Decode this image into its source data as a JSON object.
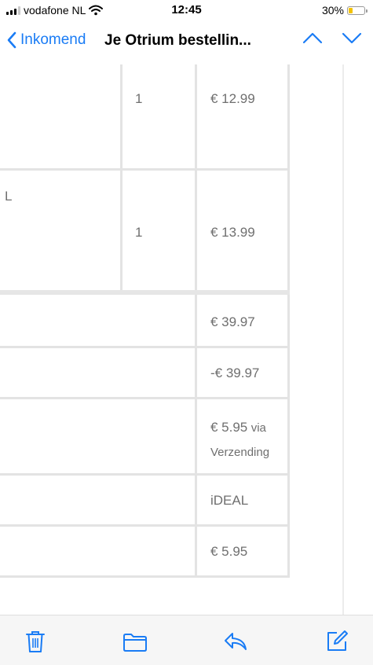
{
  "status_bar": {
    "carrier": "vodafone NL",
    "time": "12:45",
    "battery": "30%",
    "battery_level": 0.3
  },
  "nav": {
    "back_label": "Inkomend",
    "title": "Je Otrium bestellin...",
    "icons": {
      "back": "chevron-left-icon",
      "prev": "chevron-up-icon",
      "next": "chevron-down-icon"
    }
  },
  "items": [
    {
      "name": "",
      "qty": "1",
      "price": "€ 12.99"
    },
    {
      "name": "L",
      "qty": "1",
      "price": "€ 13.99"
    }
  ],
  "summary": {
    "subtotal": "€ 39.97",
    "discount": "-€ 39.97",
    "shipping_price": "€ 5.95",
    "shipping_via": "via",
    "shipping_method": "Verzending",
    "payment": "iDEAL",
    "total": "€ 5.95"
  },
  "toolbar": {
    "icons": [
      "trash-icon",
      "folder-icon",
      "reply-icon",
      "compose-icon"
    ]
  },
  "colors": {
    "accent": "#1a7cf5",
    "cell_text": "#6f6f6f",
    "grid": "#e3e3e3"
  }
}
